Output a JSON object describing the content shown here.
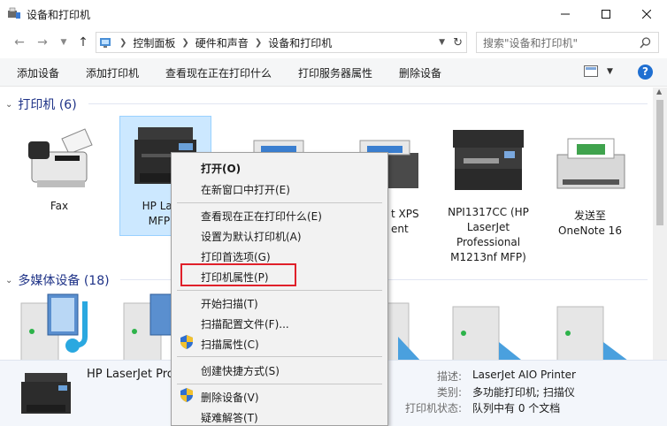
{
  "window": {
    "title": "设备和打印机"
  },
  "address": {
    "crumbs": [
      "控制面板",
      "硬件和声音",
      "设备和打印机"
    ],
    "search_placeholder": "搜索\"设备和打印机\""
  },
  "toolbar": {
    "items": [
      "添加设备",
      "添加打印机",
      "查看现在正在打印什么",
      "打印服务器属性",
      "删除设备"
    ]
  },
  "groups": {
    "printers": {
      "header": "打印机 (6)"
    },
    "media": {
      "header": "多媒体设备 (18)"
    }
  },
  "devices": [
    {
      "label": "Fax"
    },
    {
      "label": "HP Laser",
      "label2": "MFP M"
    },
    {
      "label": "",
      "label2": ""
    },
    {
      "label": "t XPS",
      "label2": "ent"
    },
    {
      "label": "NPI1317CC (HP",
      "label2": "LaserJet",
      "label3": "Professional",
      "label4": "M1213nf MFP)"
    },
    {
      "label": "发送至",
      "label2": "OneNote 16"
    }
  ],
  "context_menu": {
    "items": [
      {
        "label": "打开(O)",
        "bold": true
      },
      {
        "label": "在新窗口中打开(E)"
      },
      {
        "label": "查看现在正在打印什么(E)"
      },
      {
        "label": "设置为默认打印机(A)"
      },
      {
        "label": "打印首选项(G)"
      },
      {
        "label": "打印机属性(P)",
        "highlighted": true
      },
      {
        "label": "开始扫描(T)"
      },
      {
        "label": "扫描配置文件(F)..."
      },
      {
        "label": "扫描属性(C)",
        "shield": true
      },
      {
        "label": "创建快捷方式(S)"
      },
      {
        "label": "删除设备(V)",
        "shield": true
      },
      {
        "label": "疑难解答(T)"
      }
    ]
  },
  "details": {
    "name": "HP LaserJet Pro",
    "rows": [
      {
        "label": "描述:",
        "value": "LaserJet AIO Printer"
      },
      {
        "label": "类别:",
        "value": "多功能打印机; 扫描仪"
      },
      {
        "label": "打印机状态:",
        "value": "队列中有 0 个文档"
      }
    ]
  },
  "colors": {
    "accent": "#1e3287",
    "selection": "#cce8ff",
    "highlight_border": "#e0202a",
    "help_icon": "#1f6fd1"
  },
  "icons": {
    "back": "arrow-left-icon",
    "forward": "arrow-right-icon",
    "up": "arrow-up-icon",
    "refresh": "refresh-icon",
    "search": "search-icon",
    "help": "help-icon"
  }
}
